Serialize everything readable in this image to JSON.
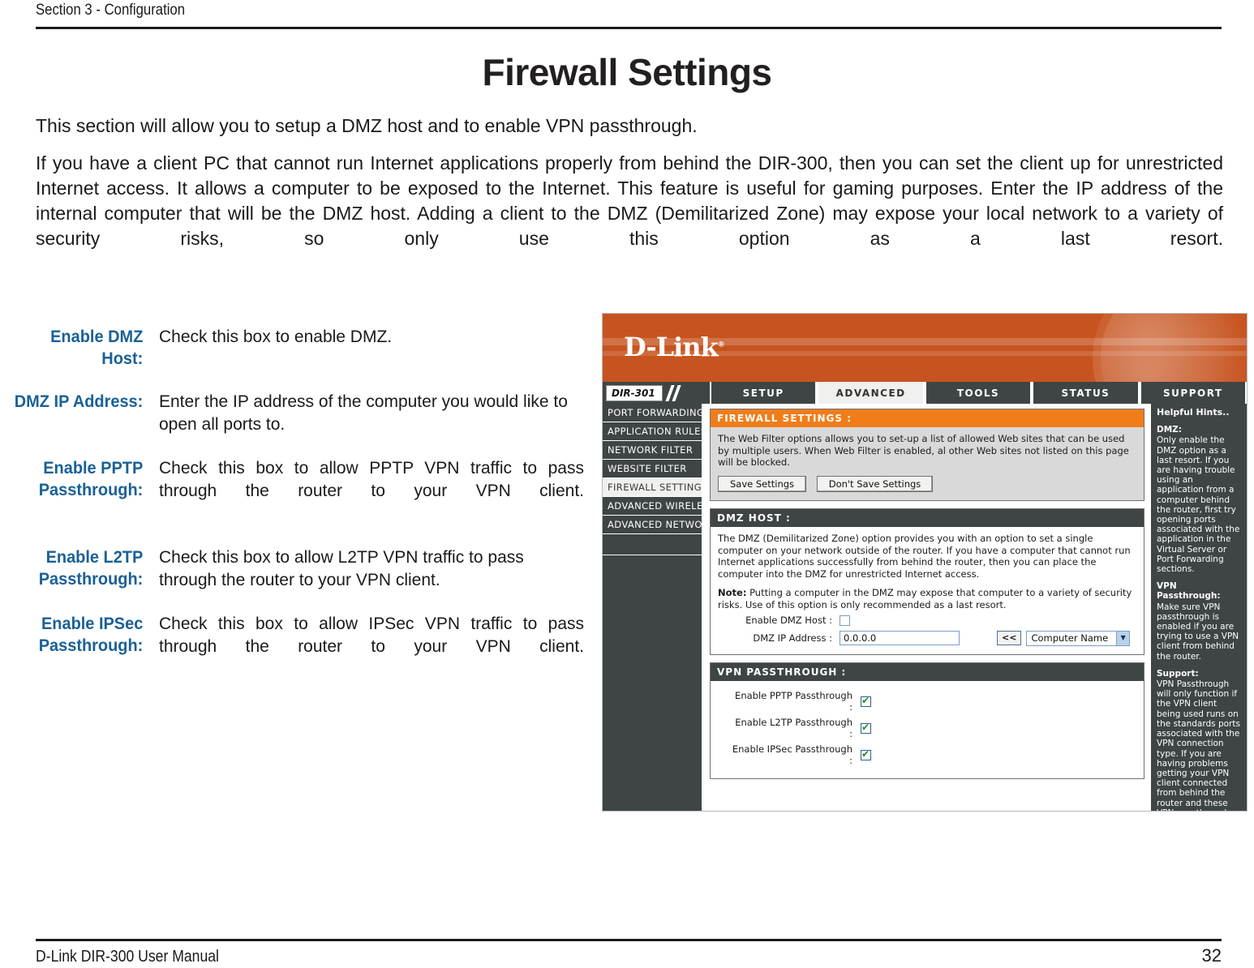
{
  "header": {
    "section_label": "Section 3 - Configuration"
  },
  "page_title": "Firewall Settings",
  "intro": {
    "p1": "This section will allow you to setup a DMZ host and to enable VPN passthrough.",
    "p2": "If you have a client PC that cannot run Internet applications properly from behind the DIR-300, then you can set the client up for unrestricted Internet access. It allows a computer to be exposed to the Internet. This feature is useful for gaming purposes. Enter the IP address of the internal computer that will be the DMZ host. Adding a client to the DMZ (Demilitarized Zone) may expose your local network to a variety of security risks, so only use this option as a last resort."
  },
  "definitions": [
    {
      "label": "Enable DMZ Host:",
      "description": "Check this box to enable DMZ."
    },
    {
      "label": "DMZ IP Address:",
      "description": "Enter the IP address of the computer you would like to open all ports to."
    },
    {
      "label": "Enable PPTP Passthrough:",
      "description": "Check this box to allow PPTP VPN traffic to pass through the router to your VPN client."
    },
    {
      "label": "Enable L2TP Passthrough:",
      "description": "Check this box to allow L2TP VPN traffic to pass through the router to your VPN client."
    },
    {
      "label": "Enable IPSec Passthrough:",
      "description": "Check this box to allow IPSec VPN traffic to pass through the router to your VPN client."
    }
  ],
  "router_ui": {
    "brand": "D-Link",
    "brand_mark": "®",
    "model": "DIR-301",
    "nav_tabs": [
      {
        "label": "SETUP",
        "active": false
      },
      {
        "label": "ADVANCED",
        "active": true
      },
      {
        "label": "TOOLS",
        "active": false
      },
      {
        "label": "STATUS",
        "active": false
      },
      {
        "label": "SUPPORT",
        "active": false
      }
    ],
    "menu_items": [
      {
        "label": "PORT FORWARDING",
        "active": false
      },
      {
        "label": "APPLICATION RULES",
        "active": false
      },
      {
        "label": "NETWORK FILTER",
        "active": false
      },
      {
        "label": "WEBSITE FILTER",
        "active": false
      },
      {
        "label": "FIREWALL SETTINGS",
        "active": true
      },
      {
        "label": "ADVANCED WIRELESS",
        "active": false
      },
      {
        "label": "ADVANCED NETWORK",
        "active": false
      }
    ],
    "firewall_panel": {
      "title": "FIREWALL SETTINGS :",
      "description": "The Web Filter options allows you to set-up a list of allowed Web sites that can be used by multiple users. When Web Filter is enabled, al other Web sites not listed on this page will be blocked.",
      "save_button": "Save Settings",
      "dont_save_button": "Don't Save Settings"
    },
    "dmz_panel": {
      "title": "DMZ HOST :",
      "description": "The DMZ (Demilitarized Zone) option provides you with an option to set a single computer on your network outside of the router. If you have a computer that cannot run Internet applications successfully from behind the router, then you can place the computer into the DMZ for unrestricted Internet access.",
      "note_label": "Note:",
      "note_text": " Putting a computer in the DMZ may expose that computer to a variety of security risks. Use of this option is only recommended as a last resort.",
      "enable_label": "Enable DMZ Host :",
      "enable_checked": false,
      "ip_label": "DMZ IP Address :",
      "ip_value": "0.0.0.0",
      "copy_button": "<<",
      "computer_select": "Computer Name"
    },
    "vpn_panel": {
      "title": "VPN PASSTHROUGH :",
      "rows": [
        {
          "label": "Enable PPTP Passthrough :",
          "checked": true
        },
        {
          "label": "Enable L2TP Passthrough :",
          "checked": true
        },
        {
          "label": "Enable IPSec Passthrough :",
          "checked": true
        }
      ]
    },
    "hints": {
      "title": "Helpful Hints..",
      "sections": [
        {
          "heading": "DMZ:",
          "text": "Only enable the DMZ option as a last resort. If you are having trouble using an application from a computer behind the router, first try opening ports associated with the application in the Virtual Server or Port Forwarding sections."
        },
        {
          "heading": "VPN Passthrough:",
          "text": "Make sure VPN passthrough is enabled if you are trying to use a VPN client from behind the router."
        },
        {
          "heading": "Support:",
          "text": "VPN Passthrough will only function if the VPN client being used runs on the standards ports associated with the VPN connection type. If you are having problems getting your VPN client connected from behind the router and these VPN passthrough options are enabled, please contact your network administrator to find out if any nonstandard ports or options are being used."
        }
      ]
    }
  },
  "footer": {
    "manual": "D-Link DIR-300 User Manual",
    "page_number": "32"
  },
  "colors": {
    "accent_blue": "#1a6196",
    "brand_orange": "#c75420",
    "panel_dark": "#3f4445",
    "panel_orange": "#f07d1a",
    "check_green": "#1c8a28"
  }
}
